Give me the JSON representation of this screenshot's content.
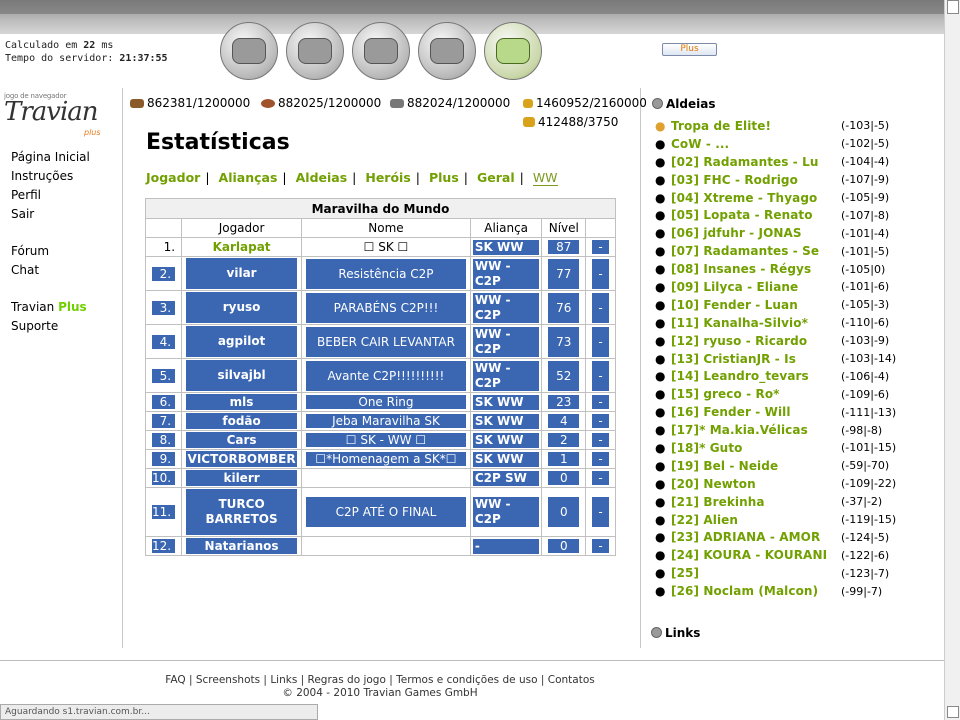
{
  "header": {
    "calc_label": "Calculado em",
    "calc_value": "22",
    "calc_unit": "ms",
    "server_label": "Tempo do servidor:",
    "server_time": "21:37:55",
    "plus_button": "Plus",
    "icons": [
      "village-overview-icon",
      "village-center-icon",
      "map-icon",
      "statistics-icon",
      "reports-icon"
    ]
  },
  "logo": {
    "sub": "jogo de navegador",
    "main": "Travian",
    "plus": "plus"
  },
  "menu": {
    "items1": [
      "Página Inicial",
      "Instruções",
      "Perfil",
      "Sair"
    ],
    "items2": [
      "Fórum",
      "Chat"
    ],
    "travian": "Travian",
    "plus": "Plus",
    "support": "Suporte"
  },
  "resources": {
    "wood": "862381/1200000",
    "clay": "882025/1200000",
    "iron": "882024/1200000",
    "crop": "1460952/2160000",
    "consumption": "412488/3750"
  },
  "page": {
    "title": "Estatísticas",
    "subnav": [
      "Jogador",
      "Alianças",
      "Aldeias",
      "Heróis",
      "Plus",
      "Geral",
      "WW"
    ]
  },
  "table": {
    "title": "Maravilha do Mundo",
    "headers": [
      "Jogador",
      "Nome",
      "Aliança",
      "Nível"
    ],
    "rows": [
      {
        "n": "1.",
        "player": "Karlapat",
        "name": "☐ SK ☐",
        "alliance": "SK WW",
        "level": "87",
        "x": "-"
      },
      {
        "n": "2.",
        "player": "vilar",
        "name": "Resistência C2P",
        "alliance": "WW - C2P",
        "level": "77",
        "x": "-"
      },
      {
        "n": "3.",
        "player": "ryuso",
        "name": "PARABÉNS C2P!!!",
        "alliance": "WW - C2P",
        "level": "76",
        "x": "-"
      },
      {
        "n": "4.",
        "player": "agpilot",
        "name": "BEBER CAIR LEVANTAR",
        "alliance": "WW - C2P",
        "level": "73",
        "x": "-"
      },
      {
        "n": "5.",
        "player": "silvajbl",
        "name": "Avante C2P!!!!!!!!!!",
        "alliance": "WW - C2P",
        "level": "52",
        "x": "-"
      },
      {
        "n": "6.",
        "player": "mls",
        "name": "One Ring",
        "alliance": "SK WW",
        "level": "23",
        "x": "-"
      },
      {
        "n": "7.",
        "player": "fodão",
        "name": "Jeba Maravilha SK",
        "alliance": "SK WW",
        "level": "4",
        "x": "-"
      },
      {
        "n": "8.",
        "player": "Cars",
        "name": "☐ SK - WW ☐",
        "alliance": "SK WW",
        "level": "2",
        "x": "-"
      },
      {
        "n": "9.",
        "player": "VICTORBOMBER",
        "name": "☐*Homenagem a SK*☐",
        "alliance": "SK WW",
        "level": "1",
        "x": "-"
      },
      {
        "n": "10.",
        "player": "kilerr",
        "name": "",
        "alliance": "C2P SW",
        "level": "0",
        "x": "-"
      },
      {
        "n": "11.",
        "player": "TURCO BARRETOS",
        "name": "C2P ATÉ O FINAL",
        "alliance": "WW - C2P",
        "level": "0",
        "x": "-"
      },
      {
        "n": "12.",
        "player": "Natarianos",
        "name": "",
        "alliance": "-",
        "level": "0",
        "x": "-"
      }
    ]
  },
  "villages": {
    "title": "Aldeias",
    "items": [
      {
        "name": "Tropa de Elite!",
        "coords": "(-103|-5)"
      },
      {
        "name": "CoW - ...",
        "coords": "(-102|-5)"
      },
      {
        "name": "[02] Radamantes - Lu",
        "coords": "(-104|-4)"
      },
      {
        "name": "[03] FHC - Rodrigo",
        "coords": "(-107|-9)"
      },
      {
        "name": "[04] Xtreme - Thyago",
        "coords": "(-105|-9)"
      },
      {
        "name": "[05] Lopata - Renato",
        "coords": "(-107|-8)"
      },
      {
        "name": "[06] jdfuhr - JONAS",
        "coords": "(-101|-4)"
      },
      {
        "name": "[07] Radamantes - Se",
        "coords": "(-101|-5)"
      },
      {
        "name": "[08] Insanes - Régys",
        "coords": "(-105|0)"
      },
      {
        "name": "[09] Lilyca - Eliane",
        "coords": "(-101|-6)"
      },
      {
        "name": "[10] Fender - Luan",
        "coords": "(-105|-3)"
      },
      {
        "name": "[11] Kanalha-Silvio*",
        "coords": "(-110|-6)"
      },
      {
        "name": "[12] ryuso - Ricardo",
        "coords": "(-103|-9)"
      },
      {
        "name": "[13] CristianJR - Is",
        "coords": "(-103|-14)"
      },
      {
        "name": "[14] Leandro_tevars",
        "coords": "(-106|-4)"
      },
      {
        "name": "[15] greco - Ro*",
        "coords": "(-109|-6)"
      },
      {
        "name": "[16] Fender - Will",
        "coords": "(-111|-13)"
      },
      {
        "name": "[17]* Ma.kia.Vélicas",
        "coords": "(-98|-8)"
      },
      {
        "name": "[18]* Guto",
        "coords": "(-101|-15)"
      },
      {
        "name": "[19] Bel - Neide",
        "coords": "(-59|-70)"
      },
      {
        "name": "[20] Newton",
        "coords": "(-109|-22)"
      },
      {
        "name": "[21] Brekinha",
        "coords": "(-37|-2)"
      },
      {
        "name": "[22] Alien",
        "coords": "(-119|-15)"
      },
      {
        "name": "[23] ADRIANA - AMOR",
        "coords": "(-124|-5)"
      },
      {
        "name": "[24] KOURA - KOURANI",
        "coords": "(-122|-6)"
      },
      {
        "name": "[25]",
        "coords": "(-123|-7)"
      },
      {
        "name": "[26] Noclam (Malcon)",
        "coords": "(-99|-7)"
      }
    ]
  },
  "links_title": "Links",
  "footer": {
    "links": [
      "FAQ",
      "Screenshots",
      "Links",
      "Regras do jogo",
      "Termos e condições de uso",
      "Contatos"
    ],
    "copyright": "© 2004 - 2010 Travian Games GmbH"
  },
  "statusbar": "Aguardando s1.travian.com.br..."
}
